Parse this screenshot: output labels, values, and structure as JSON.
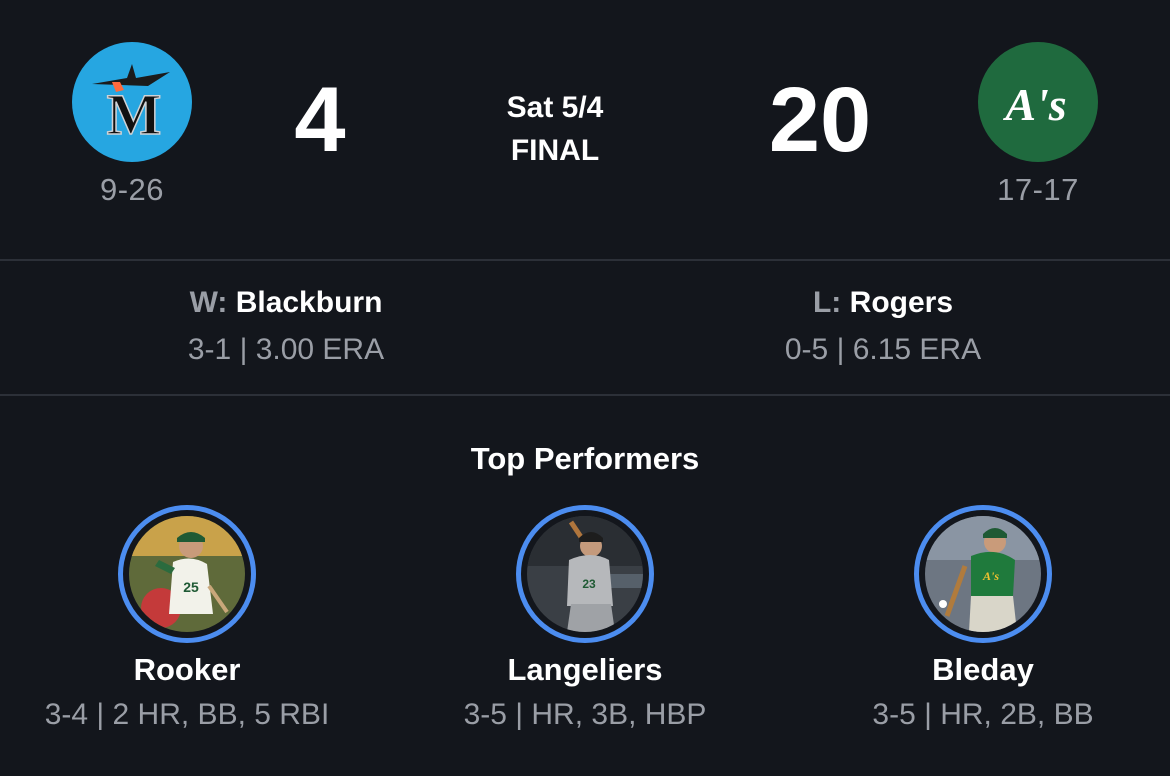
{
  "game": {
    "date": "Sat 5/4",
    "status": "FINAL"
  },
  "away_team": {
    "score": "4",
    "record": "9-26",
    "logo_icon": "marlins-logo-icon",
    "logo_text": "M",
    "color": "#26a6e1"
  },
  "home_team": {
    "score": "20",
    "record": "17-17",
    "logo_icon": "athletics-logo-icon",
    "logo_text": "A's",
    "color": "#1f6a3e"
  },
  "pitchers": {
    "winner": {
      "tag": "W:",
      "name": "Blackburn",
      "stats": "3-1 | 3.00 ERA"
    },
    "loser": {
      "tag": "L:",
      "name": "Rogers",
      "stats": "0-5 | 6.15 ERA"
    }
  },
  "top_performers": {
    "title": "Top Performers",
    "accent": "#4c8df0",
    "players": [
      {
        "name": "Rooker",
        "line": "3-4 | 2 HR, BB, 5 RBI"
      },
      {
        "name": "Langeliers",
        "line": "3-5 | HR, 3B, HBP"
      },
      {
        "name": "Bleday",
        "line": "3-5 | HR, 2B, BB"
      }
    ]
  }
}
